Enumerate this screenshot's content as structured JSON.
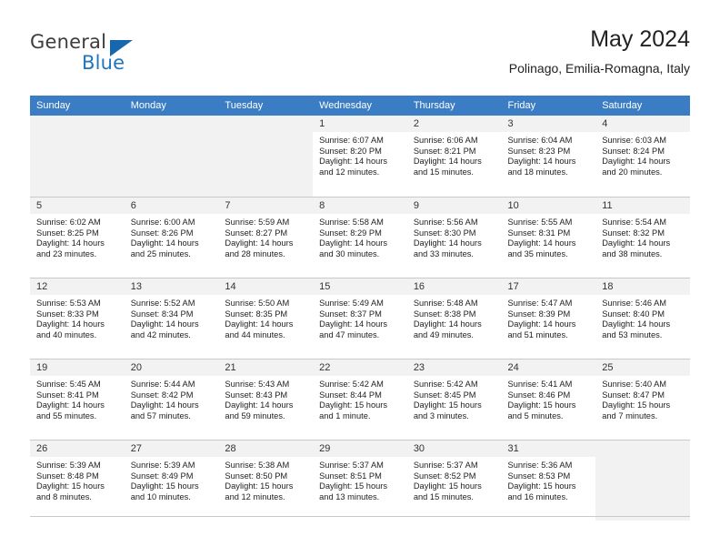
{
  "brand": {
    "name_top": "General",
    "name_bottom": "Blue",
    "accent_color": "#2175bd",
    "triangle_color": "#1667ad"
  },
  "header": {
    "title": "May 2024",
    "subtitle": "Polinago, Emilia-Romagna, Italy"
  },
  "calendar": {
    "header_bg": "#3b7dc4",
    "header_text_color": "#ffffff",
    "weekday_headers": [
      "Sunday",
      "Monday",
      "Tuesday",
      "Wednesday",
      "Thursday",
      "Friday",
      "Saturday"
    ],
    "labels": {
      "sunrise": "Sunrise:",
      "sunset": "Sunset:",
      "daylight": "Daylight:"
    },
    "weeks": [
      [
        {
          "day": "",
          "empty": true
        },
        {
          "day": "",
          "empty": true
        },
        {
          "day": "",
          "empty": true
        },
        {
          "day": "1",
          "sunrise": "Sunrise: 6:07 AM",
          "sunset": "Sunset: 8:20 PM",
          "daylight_1": "Daylight: 14 hours",
          "daylight_2": "and 12 minutes."
        },
        {
          "day": "2",
          "sunrise": "Sunrise: 6:06 AM",
          "sunset": "Sunset: 8:21 PM",
          "daylight_1": "Daylight: 14 hours",
          "daylight_2": "and 15 minutes."
        },
        {
          "day": "3",
          "sunrise": "Sunrise: 6:04 AM",
          "sunset": "Sunset: 8:23 PM",
          "daylight_1": "Daylight: 14 hours",
          "daylight_2": "and 18 minutes."
        },
        {
          "day": "4",
          "sunrise": "Sunrise: 6:03 AM",
          "sunset": "Sunset: 8:24 PM",
          "daylight_1": "Daylight: 14 hours",
          "daylight_2": "and 20 minutes."
        }
      ],
      [
        {
          "day": "5",
          "sunrise": "Sunrise: 6:02 AM",
          "sunset": "Sunset: 8:25 PM",
          "daylight_1": "Daylight: 14 hours",
          "daylight_2": "and 23 minutes."
        },
        {
          "day": "6",
          "sunrise": "Sunrise: 6:00 AM",
          "sunset": "Sunset: 8:26 PM",
          "daylight_1": "Daylight: 14 hours",
          "daylight_2": "and 25 minutes."
        },
        {
          "day": "7",
          "sunrise": "Sunrise: 5:59 AM",
          "sunset": "Sunset: 8:27 PM",
          "daylight_1": "Daylight: 14 hours",
          "daylight_2": "and 28 minutes."
        },
        {
          "day": "8",
          "sunrise": "Sunrise: 5:58 AM",
          "sunset": "Sunset: 8:29 PM",
          "daylight_1": "Daylight: 14 hours",
          "daylight_2": "and 30 minutes."
        },
        {
          "day": "9",
          "sunrise": "Sunrise: 5:56 AM",
          "sunset": "Sunset: 8:30 PM",
          "daylight_1": "Daylight: 14 hours",
          "daylight_2": "and 33 minutes."
        },
        {
          "day": "10",
          "sunrise": "Sunrise: 5:55 AM",
          "sunset": "Sunset: 8:31 PM",
          "daylight_1": "Daylight: 14 hours",
          "daylight_2": "and 35 minutes."
        },
        {
          "day": "11",
          "sunrise": "Sunrise: 5:54 AM",
          "sunset": "Sunset: 8:32 PM",
          "daylight_1": "Daylight: 14 hours",
          "daylight_2": "and 38 minutes."
        }
      ],
      [
        {
          "day": "12",
          "sunrise": "Sunrise: 5:53 AM",
          "sunset": "Sunset: 8:33 PM",
          "daylight_1": "Daylight: 14 hours",
          "daylight_2": "and 40 minutes."
        },
        {
          "day": "13",
          "sunrise": "Sunrise: 5:52 AM",
          "sunset": "Sunset: 8:34 PM",
          "daylight_1": "Daylight: 14 hours",
          "daylight_2": "and 42 minutes."
        },
        {
          "day": "14",
          "sunrise": "Sunrise: 5:50 AM",
          "sunset": "Sunset: 8:35 PM",
          "daylight_1": "Daylight: 14 hours",
          "daylight_2": "and 44 minutes."
        },
        {
          "day": "15",
          "sunrise": "Sunrise: 5:49 AM",
          "sunset": "Sunset: 8:37 PM",
          "daylight_1": "Daylight: 14 hours",
          "daylight_2": "and 47 minutes."
        },
        {
          "day": "16",
          "sunrise": "Sunrise: 5:48 AM",
          "sunset": "Sunset: 8:38 PM",
          "daylight_1": "Daylight: 14 hours",
          "daylight_2": "and 49 minutes."
        },
        {
          "day": "17",
          "sunrise": "Sunrise: 5:47 AM",
          "sunset": "Sunset: 8:39 PM",
          "daylight_1": "Daylight: 14 hours",
          "daylight_2": "and 51 minutes."
        },
        {
          "day": "18",
          "sunrise": "Sunrise: 5:46 AM",
          "sunset": "Sunset: 8:40 PM",
          "daylight_1": "Daylight: 14 hours",
          "daylight_2": "and 53 minutes."
        }
      ],
      [
        {
          "day": "19",
          "sunrise": "Sunrise: 5:45 AM",
          "sunset": "Sunset: 8:41 PM",
          "daylight_1": "Daylight: 14 hours",
          "daylight_2": "and 55 minutes."
        },
        {
          "day": "20",
          "sunrise": "Sunrise: 5:44 AM",
          "sunset": "Sunset: 8:42 PM",
          "daylight_1": "Daylight: 14 hours",
          "daylight_2": "and 57 minutes."
        },
        {
          "day": "21",
          "sunrise": "Sunrise: 5:43 AM",
          "sunset": "Sunset: 8:43 PM",
          "daylight_1": "Daylight: 14 hours",
          "daylight_2": "and 59 minutes."
        },
        {
          "day": "22",
          "sunrise": "Sunrise: 5:42 AM",
          "sunset": "Sunset: 8:44 PM",
          "daylight_1": "Daylight: 15 hours",
          "daylight_2": "and 1 minute."
        },
        {
          "day": "23",
          "sunrise": "Sunrise: 5:42 AM",
          "sunset": "Sunset: 8:45 PM",
          "daylight_1": "Daylight: 15 hours",
          "daylight_2": "and 3 minutes."
        },
        {
          "day": "24",
          "sunrise": "Sunrise: 5:41 AM",
          "sunset": "Sunset: 8:46 PM",
          "daylight_1": "Daylight: 15 hours",
          "daylight_2": "and 5 minutes."
        },
        {
          "day": "25",
          "sunrise": "Sunrise: 5:40 AM",
          "sunset": "Sunset: 8:47 PM",
          "daylight_1": "Daylight: 15 hours",
          "daylight_2": "and 7 minutes."
        }
      ],
      [
        {
          "day": "26",
          "sunrise": "Sunrise: 5:39 AM",
          "sunset": "Sunset: 8:48 PM",
          "daylight_1": "Daylight: 15 hours",
          "daylight_2": "and 8 minutes."
        },
        {
          "day": "27",
          "sunrise": "Sunrise: 5:39 AM",
          "sunset": "Sunset: 8:49 PM",
          "daylight_1": "Daylight: 15 hours",
          "daylight_2": "and 10 minutes."
        },
        {
          "day": "28",
          "sunrise": "Sunrise: 5:38 AM",
          "sunset": "Sunset: 8:50 PM",
          "daylight_1": "Daylight: 15 hours",
          "daylight_2": "and 12 minutes."
        },
        {
          "day": "29",
          "sunrise": "Sunrise: 5:37 AM",
          "sunset": "Sunset: 8:51 PM",
          "daylight_1": "Daylight: 15 hours",
          "daylight_2": "and 13 minutes."
        },
        {
          "day": "30",
          "sunrise": "Sunrise: 5:37 AM",
          "sunset": "Sunset: 8:52 PM",
          "daylight_1": "Daylight: 15 hours",
          "daylight_2": "and 15 minutes."
        },
        {
          "day": "31",
          "sunrise": "Sunrise: 5:36 AM",
          "sunset": "Sunset: 8:53 PM",
          "daylight_1": "Daylight: 15 hours",
          "daylight_2": "and 16 minutes."
        },
        {
          "day": "",
          "empty": true
        }
      ]
    ]
  }
}
